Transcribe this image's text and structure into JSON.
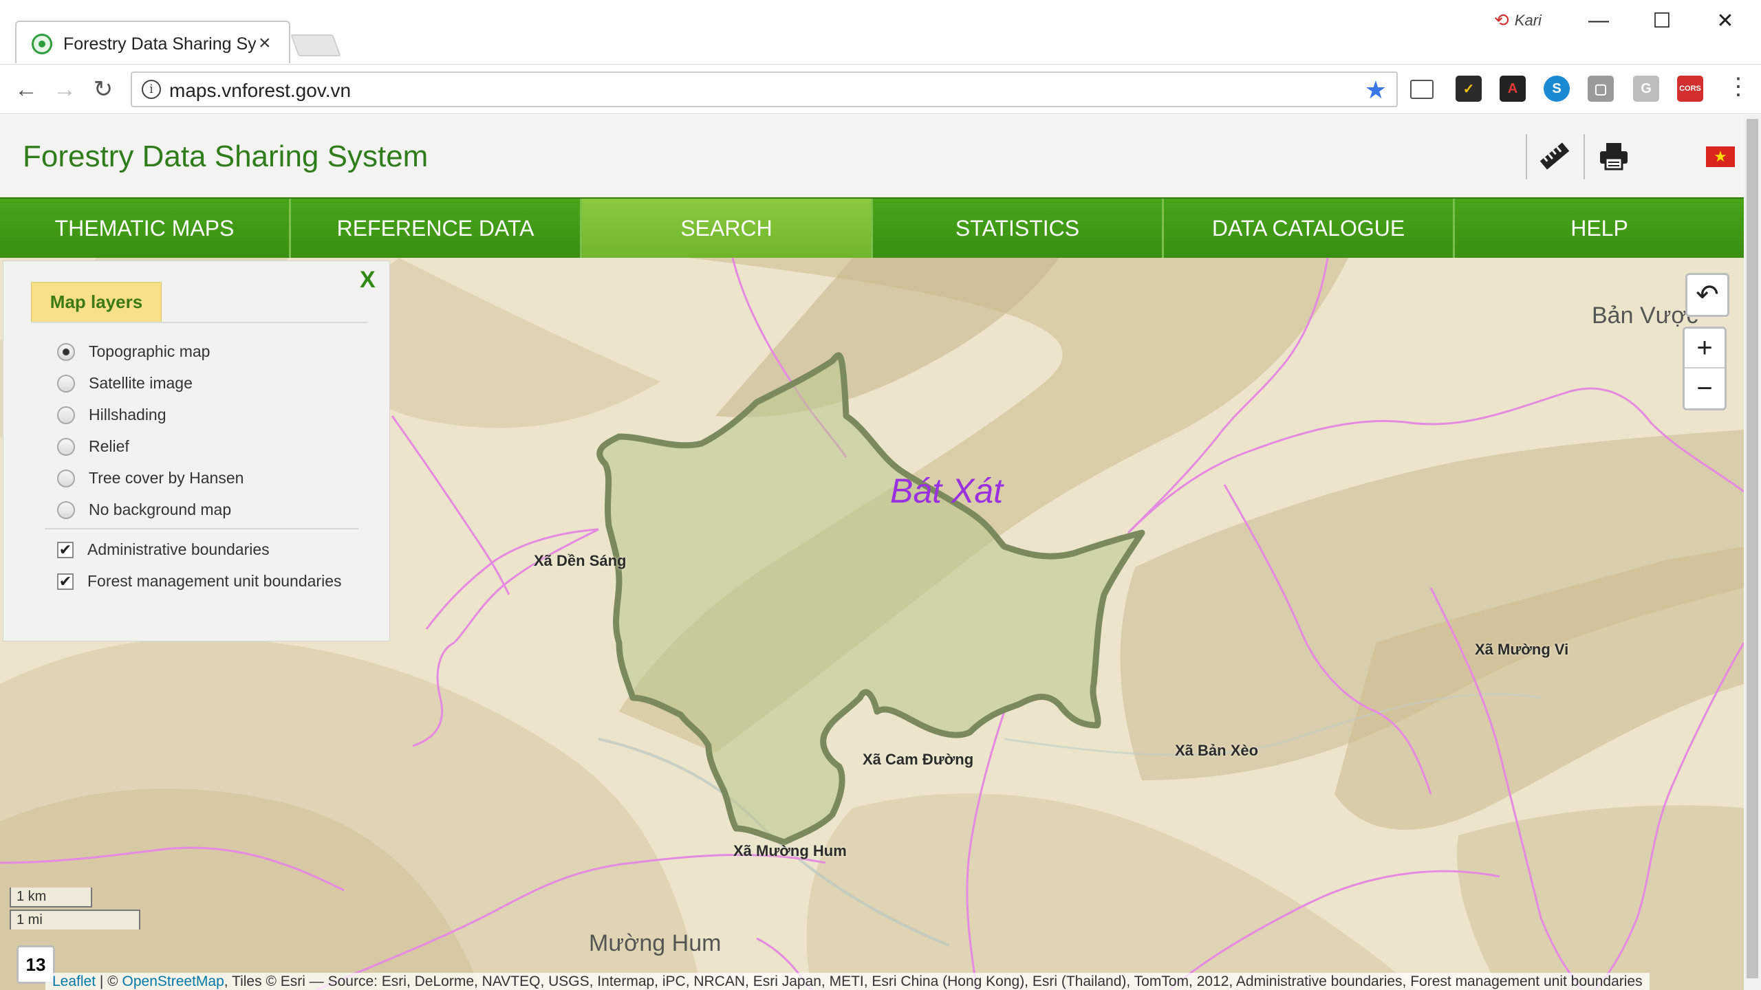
{
  "browser": {
    "tab_title": "Forestry Data Sharing Sys",
    "tab_close": "×",
    "url": "maps.vnforest.gov.vn",
    "profile_name": "Kari",
    "window_controls": [
      "—",
      "☐",
      "✕"
    ],
    "nav_back": "←",
    "nav_forward": "→",
    "nav_reload": "↻",
    "info_glyph": "i",
    "bookmark_star": "★",
    "menu_glyph": "⋮",
    "extensions": [
      {
        "name": "cast-icon",
        "glyph": "▭",
        "color": "#ffffff"
      },
      {
        "name": "norton-icon",
        "glyph": "✓",
        "color": "#2b2b2b"
      },
      {
        "name": "acrobat-icon",
        "glyph": "A",
        "color": "#222222"
      },
      {
        "name": "skype-icon",
        "glyph": "S",
        "color": "#1a8ad4"
      },
      {
        "name": "extension-gray-icon",
        "glyph": "▢",
        "color": "#9a9a9a"
      },
      {
        "name": "google-g-icon",
        "glyph": "G",
        "color": "#bdbdbd"
      },
      {
        "name": "cors-icon",
        "glyph": "CORS",
        "color": "#d32f2f"
      }
    ]
  },
  "app": {
    "title": "Forestry Data Sharing System",
    "flag_star": "★"
  },
  "nav": {
    "items": [
      "THEMATIC MAPS",
      "REFERENCE DATA",
      "SEARCH",
      "STATISTICS",
      "DATA CATALOGUE",
      "HELP"
    ],
    "active": "SEARCH"
  },
  "layers_panel": {
    "tab_label": "Map layers",
    "close_label": "X",
    "base_layers": [
      {
        "label": "Topographic map",
        "selected": true
      },
      {
        "label": "Satellite image",
        "selected": false
      },
      {
        "label": "Hillshading",
        "selected": false
      },
      {
        "label": "Relief",
        "selected": false
      },
      {
        "label": "Tree cover by Hansen",
        "selected": false
      },
      {
        "label": "No background map",
        "selected": false
      }
    ],
    "overlays": [
      {
        "label": "Administrative boundaries",
        "checked": true
      },
      {
        "label": "Forest management unit boundaries",
        "checked": true
      }
    ],
    "check_mark": "✔"
  },
  "map": {
    "district_label": "Bát Xát",
    "labels": {
      "den_sang": "Xã Dền Sáng",
      "cam_duong": "Xã Cam Đường",
      "muong_hum_commune": "Xã Mường Hum",
      "ban_xeo": "Xã Bản Xèo",
      "muong_vi": "Xã Mường Vi"
    },
    "region_labels": {
      "ban_vuoc": "Bản Vược",
      "muong_hum": "Mường Hum"
    },
    "zoom_level": "13",
    "zoom_in": "+",
    "zoom_out": "−",
    "back_glyph": "↶",
    "scale_km": "1 km",
    "scale_mi": "1 mi",
    "attribution": {
      "leaflet": "Leaflet",
      "separator": " | © ",
      "osm": "OpenStreetMap",
      "rest": ", Tiles © Esri — Source: Esri, DeLorme, NAVTEQ, USGS, Intermap, iPC, NRCAN, Esri Japan, METI, Esri China (Hong Kong), Esri (Thailand), TomTom, 2012, Administrative boundaries, Forest management unit boundaries"
    }
  }
}
